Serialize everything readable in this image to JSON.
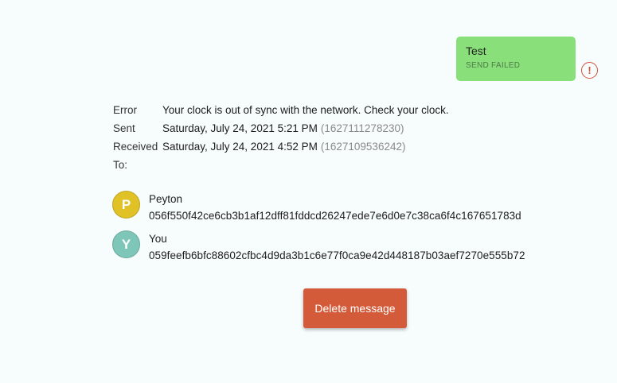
{
  "message": {
    "text": "Test",
    "status": "SEND FAILED",
    "alert_icon": "exclamation-circle-icon",
    "alert_glyph": "!",
    "bubble_color": "#89e07a"
  },
  "details": {
    "error_label": "Error",
    "error_value": "Your clock is out of sync with the network. Check your clock.",
    "sent_label": "Sent",
    "sent_value": "Saturday, July 24, 2021 5:21 PM",
    "sent_timestamp": "(1627111278230)",
    "received_label": "Received",
    "received_value": "Saturday, July 24, 2021 4:52 PM",
    "received_timestamp": "(1627109536242)",
    "to_label": "To:"
  },
  "recipients": [
    {
      "initial": "P",
      "name": "Peyton",
      "key": "056f550f42ce6cb3b1af12dff81fddcd26247ede7e6d0e7c38ca6f4c167651783d",
      "color": "#e0c227"
    },
    {
      "initial": "Y",
      "name": "You",
      "key": "059feefb6bfc88602cfbc4d9da3b1c6e77f0ca9e42d448187b03aef7270e555b72",
      "color": "#7ec7b8"
    }
  ],
  "actions": {
    "delete_label": "Delete message",
    "delete_color": "#d45b3a"
  }
}
